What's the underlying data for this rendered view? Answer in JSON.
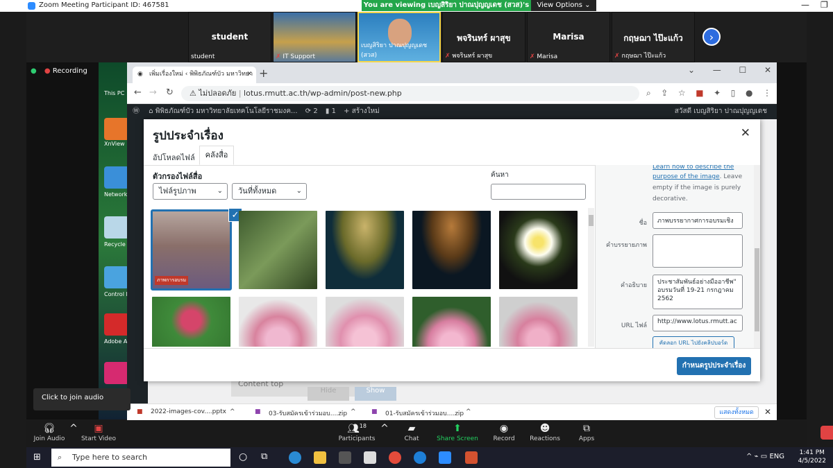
{
  "zoom": {
    "window_title": "Zoom Meeting Participant ID: 467581",
    "viewing_banner": "You are viewing เบญสิริยา ปาณปุญญเดช (สวส)'s screen",
    "view_options": "View Options ⌄",
    "recording": "Recording",
    "participants_tiles": [
      {
        "big": "student",
        "name": "student"
      },
      {
        "big": "",
        "name": "IT Support"
      },
      {
        "big": "",
        "name": "เบญสิริยา ปาณปุญญเดช (สวส)"
      },
      {
        "big": "พจรินทร์ ผาสุข",
        "name": "พจรินทร์ ผาสุข"
      },
      {
        "big": "Marisa",
        "name": "Marisa"
      },
      {
        "big": "กฤษฌา ไป๊ะแก้ว",
        "name": "กฤษฌา ไป๊ะแก้ว"
      }
    ],
    "tooltip": "Click to join audio",
    "toolbar": {
      "join_audio": "Join Audio",
      "start_video": "Start Video",
      "participants": "Participants",
      "participants_count": "18",
      "chat": "Chat",
      "share_screen": "Share Screen",
      "record": "Record",
      "reactions": "Reactions",
      "apps": "Apps"
    }
  },
  "desktop": {
    "icons": [
      "This PC",
      "XnView",
      "Network",
      "Recycle Bin",
      "Control Panel",
      "Adobe Acrobat",
      ""
    ]
  },
  "browser": {
    "tab_title": "เพิ่มเรื่องใหม่ ‹ พิพิธภัณฑ์บัว มหาวิทยา",
    "not_secure": "ไม่ปลอดภัย",
    "url": "lotus.rmutt.ac.th/wp-admin/post-new.php",
    "wp_site": "พิพิธภัณฑ์บัว มหาวิทยาลัยเทคโนโลยีราชมงค...",
    "wp_updates": "2",
    "wp_comments": "1",
    "wp_new": "สร้างใหม่",
    "wp_greeting": "สวัสดี เบญสิริยา ปาณปุญญเดช"
  },
  "modal": {
    "title": "รูปประจำเรื่อง",
    "tab_upload": "อัปโหลดไฟล์",
    "tab_library": "คลังสื่อ",
    "filter_label": "ตัวกรองไฟล์สื่อ",
    "filter_type": "ไฟล์รูปภาพ",
    "filter_date": "วันที่ทั้งหมด",
    "search_label": "ค้นหา",
    "thumb_caption": "ภาพการอบรม",
    "sidebar": {
      "link1": "Learn how to describe the",
      "link2": "purpose of the image",
      "hint_a": ". Leave",
      "hint_b": "empty if the image is purely",
      "hint_c": "decorative.",
      "title_label": "ชื่อ",
      "title_value": "ภาพบรรยากาศการอบรมเชิง",
      "caption_label": "คำบรรยายภาพ",
      "desc_label": "คำอธิบาย",
      "desc_value": "ประชาสัมพันธ์อย่างมืออาชีพ\" อบรมวันที่ 19-21 กรกฎาคม 2562",
      "url_label": "URL ไฟล์",
      "url_value": "http://www.lotus.rmutt.ac",
      "copy_button": "คัดลอก URL ไปยังคลิปบอร์ด"
    },
    "set_button": "กำหนดรูปประจำเรื่อง"
  },
  "behind": {
    "content_top": "Content top",
    "hide": "Hide",
    "show": "Show"
  },
  "downloads": {
    "items": [
      "2022-images-cov....pptx",
      "03-รับสมัครเข้าร่วมอบ....zip",
      "01-รับสมัครเข้าร่วมอบ....zip"
    ],
    "show_all": "แสดงทั้งหมด"
  },
  "taskbar": {
    "search_placeholder": "Type here to search",
    "lang": "ENG",
    "time": "1:41 PM",
    "date": "4/5/2022"
  }
}
